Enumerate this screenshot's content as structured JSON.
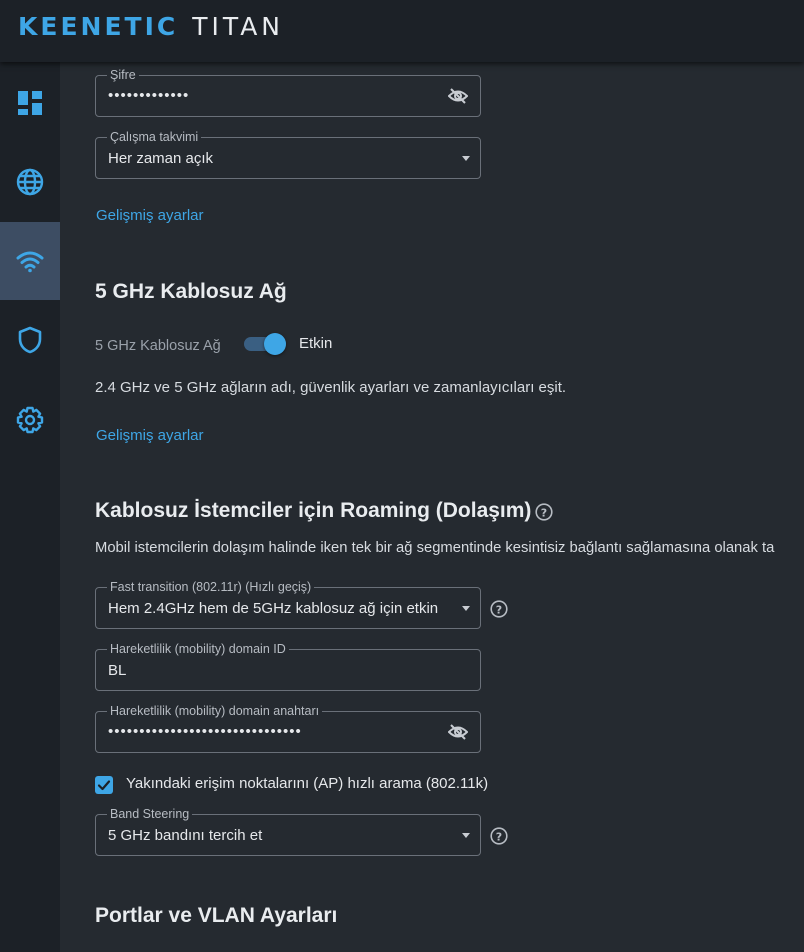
{
  "header": {
    "brand": "KEENETIC",
    "model": "TITAN"
  },
  "sidebar": {
    "items": [
      {
        "name": "dashboard-icon"
      },
      {
        "name": "globe-icon"
      },
      {
        "name": "wifi-icon",
        "active": true
      },
      {
        "name": "shield-icon"
      },
      {
        "name": "gear-icon"
      }
    ]
  },
  "wifi24": {
    "password_label": "Şifre",
    "password_value": "•••••••••••••",
    "schedule_label": "Çalışma takvimi",
    "schedule_value": "Her zaman açık",
    "advanced_link": "Gelişmiş ayarlar"
  },
  "wifi5": {
    "heading": "5 GHz Kablosuz Ağ",
    "toggle_label": "5 GHz Kablosuz Ağ",
    "toggle_state": "Etkin",
    "note": "2.4 GHz ve 5 GHz ağların adı, güvenlik ayarları ve zamanlayıcıları eşit.",
    "advanced_link": "Gelişmiş ayarlar"
  },
  "roaming": {
    "heading": "Kablosuz İstemciler için Roaming (Dolaşım)",
    "description": "Mobil istemcilerin dolaşım halinde iken tek bir ağ segmentinde kesintisiz bağlantı sağlamasına olanak ta",
    "fast_transition_label": "Fast transition (802.11r) (Hızlı geçiş)",
    "fast_transition_value": "Hem 2.4GHz hem de 5GHz kablosuz ağ için etkin",
    "mobility_id_label": "Hareketlilik (mobility) domain ID",
    "mobility_id_value": "BL",
    "mobility_key_label": "Hareketlilik (mobility) domain anahtarı",
    "mobility_key_value": "•••••••••••••••••••••••••••••••",
    "fast_scan_label": "Yakındaki erişim noktalarını (AP) hızlı arama (802.11k)",
    "fast_scan_checked": true,
    "band_steering_label": "Band Steering",
    "band_steering_value": "5 GHz bandını tercih et"
  },
  "ports": {
    "heading": "Portlar ve VLAN Ayarları"
  },
  "colors": {
    "accent": "#3ea6e6",
    "background": "#252a30",
    "sidebar": "#1c2127",
    "active_nav": "#3d4d63"
  }
}
